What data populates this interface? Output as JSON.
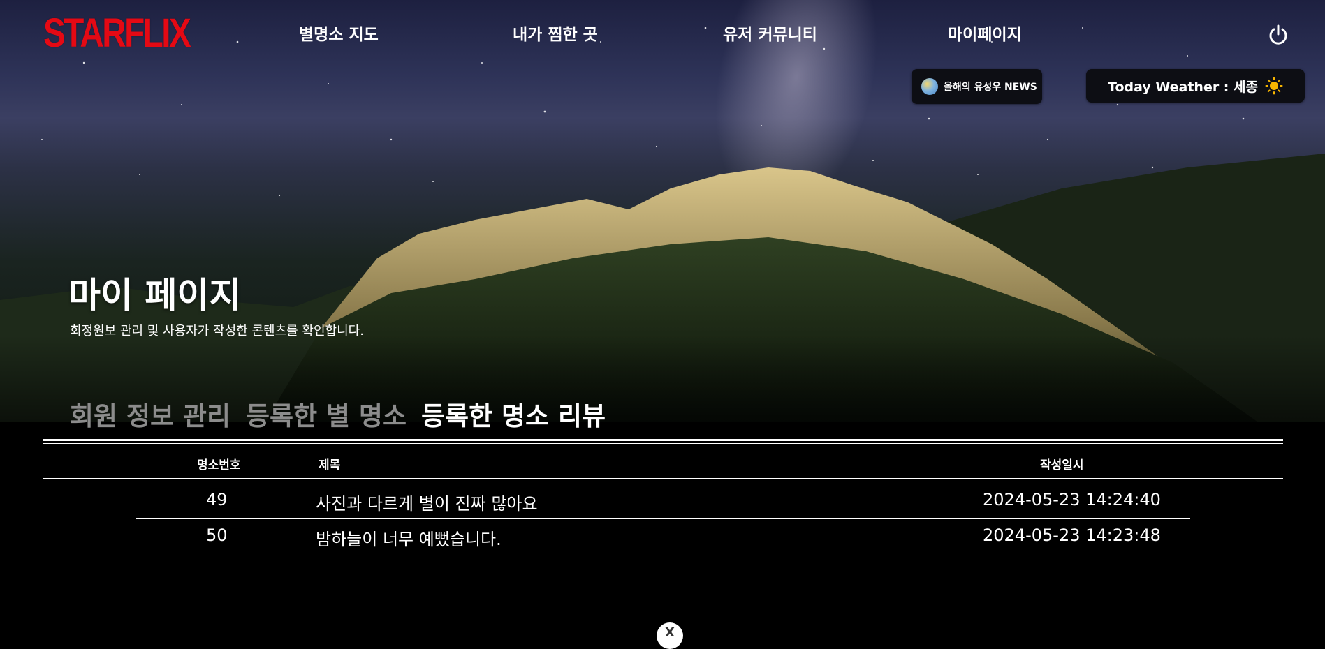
{
  "brand": {
    "logo_text": "STARFLIX",
    "logo_color": "#e50914"
  },
  "nav": {
    "items": [
      {
        "label": "별명소 지도"
      },
      {
        "label": "내가 찜한 곳"
      },
      {
        "label": "유저 커뮤니티"
      },
      {
        "label": "마이페이지"
      }
    ],
    "power_icon": "power-icon"
  },
  "news_button": {
    "label": "올해의 유성우 NEWS",
    "icon": "globe-icon"
  },
  "weather": {
    "label": "Today Weather : 세종",
    "icon": "sun-icon"
  },
  "hero": {
    "title": "마이 페이지",
    "subtitle": "회정원보 관리 및 사용자가 작성한 콘텐츠를 확인합니다."
  },
  "tabs": [
    {
      "label": "회원 정보 관리",
      "active": false
    },
    {
      "label": "등록한 별 명소",
      "active": false
    },
    {
      "label": "등록한 명소 리뷰",
      "active": true
    }
  ],
  "table": {
    "headers": {
      "number": "명소번호",
      "title": "제목",
      "date": "작성일시"
    },
    "rows": [
      {
        "number": "49",
        "title": "사진과 다르게 별이 진짜 많아요",
        "date": "2024-05-23 14:24:40"
      },
      {
        "number": "50",
        "title": "밤하늘이 너무 예뻤습니다.",
        "date": "2024-05-23 14:23:48"
      }
    ]
  },
  "scroll_top_button": {
    "label": "X"
  }
}
